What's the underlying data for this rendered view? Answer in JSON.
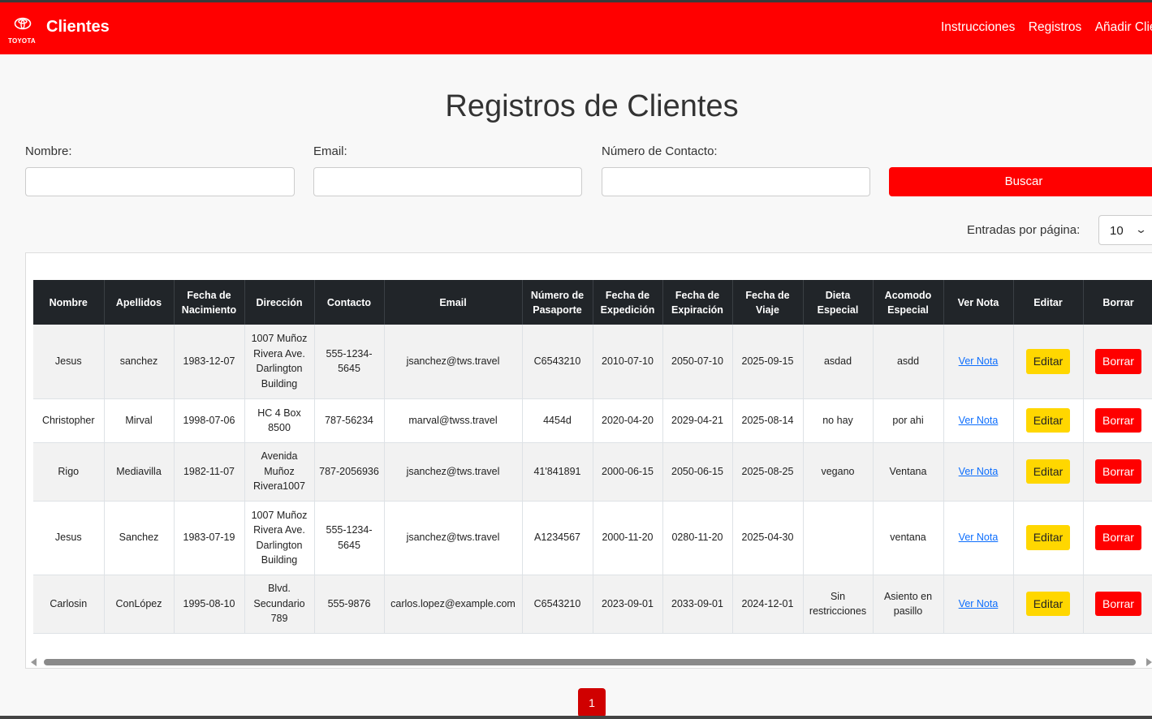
{
  "navbar": {
    "logo_text": "TOYOTA",
    "brand": "Clientes",
    "links": [
      "Instrucciones",
      "Registros",
      "Añadir Clientes"
    ]
  },
  "page_title": "Registros de Clientes",
  "search": {
    "name_label": "Nombre:",
    "email_label": "Email:",
    "contact_label": "Número de Contacto:",
    "name_value": "",
    "email_value": "",
    "contact_value": "",
    "button_label": "Buscar"
  },
  "entries": {
    "label": "Entradas por página:",
    "value": "10"
  },
  "table": {
    "headers": [
      "Nombre",
      "Apellidos",
      "Fecha de Nacimiento",
      "Dirección",
      "Contacto",
      "Email",
      "Número de Pasaporte",
      "Fecha de Expedición",
      "Fecha de Expiración",
      "Fecha de Viaje",
      "Dieta Especial",
      "Acomodo Especial",
      "Ver Nota",
      "Editar",
      "Borrar"
    ],
    "rows": [
      {
        "nombre": "Jesus",
        "apellidos": "sanchez",
        "nacimiento": "1983-12-07",
        "direccion": "1007 Muñoz Rivera Ave. Darlington Building",
        "contacto": "555-1234-5645",
        "email": "jsanchez@tws.travel",
        "pasaporte": "C6543210",
        "expedicion": "2010-07-10",
        "expiracion": "2050-07-10",
        "viaje": "2025-09-15",
        "dieta": "asdad",
        "acomodo": "asdd"
      },
      {
        "nombre": "Christopher",
        "apellidos": "Mirval",
        "nacimiento": "1998-07-06",
        "direccion": "HC 4 Box 8500",
        "contacto": "787-56234",
        "email": "marval@twss.travel",
        "pasaporte": "4454d",
        "expedicion": "2020-04-20",
        "expiracion": "2029-04-21",
        "viaje": "2025-08-14",
        "dieta": "no hay",
        "acomodo": "por ahi"
      },
      {
        "nombre": "Rigo",
        "apellidos": "Mediavilla",
        "nacimiento": "1982-11-07",
        "direccion": "Avenida Muñoz Rivera1007",
        "contacto": "787-2056936",
        "email": "jsanchez@tws.travel",
        "pasaporte": "41'841891",
        "expedicion": "2000-06-15",
        "expiracion": "2050-06-15",
        "viaje": "2025-08-25",
        "dieta": "vegano",
        "acomodo": "Ventana"
      },
      {
        "nombre": "Jesus",
        "apellidos": "Sanchez",
        "nacimiento": "1983-07-19",
        "direccion": "1007 Muñoz Rivera Ave. Darlington Building",
        "contacto": "555-1234-5645",
        "email": "jsanchez@tws.travel",
        "pasaporte": "A1234567",
        "expedicion": "2000-11-20",
        "expiracion": "0280-11-20",
        "viaje": "2025-04-30",
        "dieta": "",
        "acomodo": "ventana"
      },
      {
        "nombre": "Carlosin",
        "apellidos": "ConLópez",
        "nacimiento": "1995-08-10",
        "direccion": "Blvd. Secundario 789",
        "contacto": "555-9876",
        "email": "carlos.lopez@example.com",
        "pasaporte": "C6543210",
        "expedicion": "2023-09-01",
        "expiracion": "2033-09-01",
        "viaje": "2024-12-01",
        "dieta": "Sin restricciones",
        "acomodo": "Asiento en pasillo"
      }
    ],
    "ver_nota_label": "Ver Nota",
    "editar_label": "Editar",
    "borrar_label": "Borrar"
  },
  "pagination": {
    "current": "1"
  },
  "colors": {
    "brand_red": "#ff0000",
    "edit_yellow": "#ffd700",
    "header_dark": "#212529",
    "link_blue": "#0d6efd"
  }
}
